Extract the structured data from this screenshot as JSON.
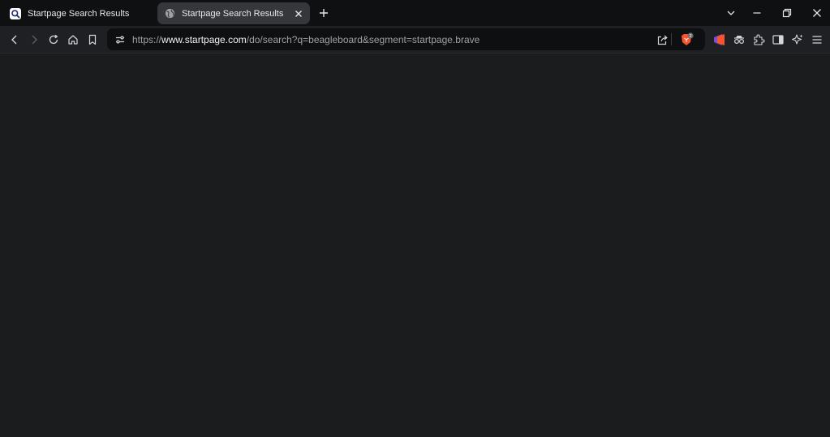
{
  "tabs": [
    {
      "title": "Startpage Search Results",
      "favicon": "startpage-search-icon",
      "active": false
    },
    {
      "title": "Startpage Search Results",
      "favicon": "globe-icon",
      "active": true
    }
  ],
  "window_controls": [
    "chevron-down-icon",
    "minimize-icon",
    "restore-icon",
    "close-icon"
  ],
  "toolbar": {
    "nav_icons": [
      "back-arrow-icon",
      "forward-arrow-icon",
      "reload-icon",
      "home-icon",
      "bookmark-icon"
    ],
    "url": {
      "scheme": "https://",
      "host": "www.startpage.com",
      "path": "/do/search?q=beagleboard&segment=startpage.brave"
    },
    "url_icons": [
      "site-settings-icon",
      "share-icon",
      "brave-shields-icon"
    ],
    "shields_badge": "2",
    "right_icons": [
      "brave-rewards-icon",
      "private-window-icon",
      "extensions-icon",
      "sidebar-icon",
      "leo-ai-icon",
      "menu-icon"
    ]
  },
  "colors": {
    "tabstrip_bg": "#0f1012",
    "toolbar_bg": "#1f2023",
    "active_tab_bg": "#35373a",
    "content_bg": "#1b1c1e",
    "brave_orange": "#fb542b"
  }
}
